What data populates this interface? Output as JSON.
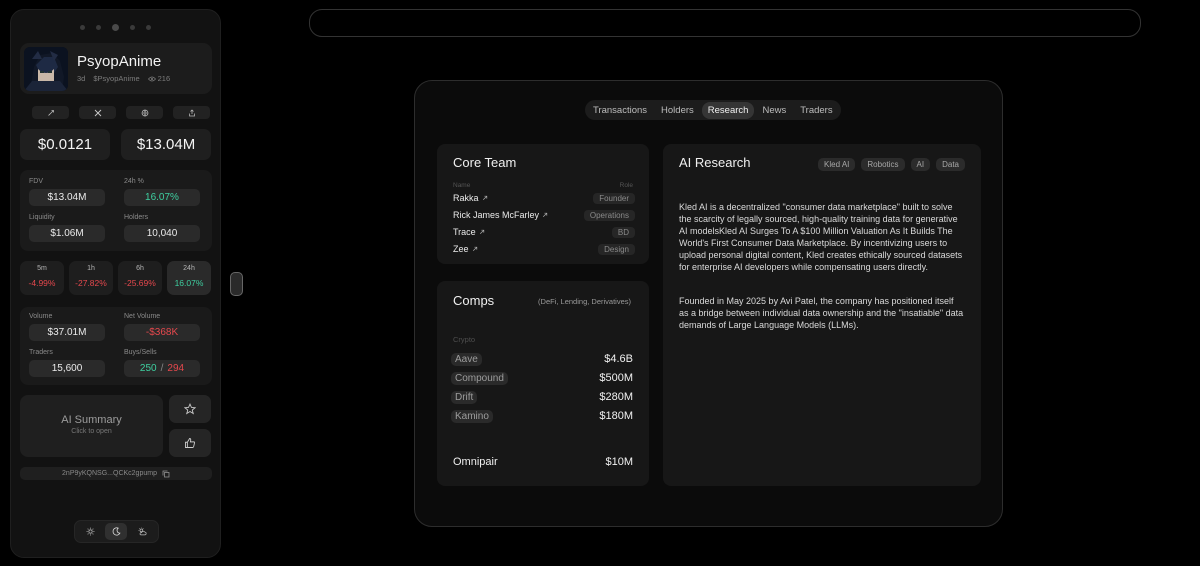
{
  "profile": {
    "name": "PsyopAnime",
    "age": "3d",
    "ticker": "$PsyopAnime",
    "views": "216"
  },
  "prices": {
    "price": "$0.0121",
    "mcap": "$13.04M"
  },
  "stats": {
    "fdv_label": "FDV",
    "fdv": "$13.04M",
    "change_label": "24h %",
    "change": "16.07%",
    "liquidity_label": "Liquidity",
    "liquidity": "$1.06M",
    "holders_label": "Holders",
    "holders": "10,040"
  },
  "timeframes": [
    {
      "label": "5m",
      "value": "-4.99%"
    },
    {
      "label": "1h",
      "value": "-27.82%"
    },
    {
      "label": "6h",
      "value": "-25.69%"
    },
    {
      "label": "24h",
      "value": "16.07%"
    }
  ],
  "volume": {
    "volume_label": "Volume",
    "volume": "$37.01M",
    "net_label": "Net Volume",
    "net": "-$368K",
    "traders_label": "Traders",
    "traders": "15,600",
    "buysells_label": "Buys/Sells",
    "buys": "250",
    "sep": "/",
    "sells": "294"
  },
  "ai_summary": {
    "title": "AI Summary",
    "subtitle": "Click to open"
  },
  "address": "2nP9yKQNSG...QCKc2gpump",
  "tabs": [
    "Transactions",
    "Holders",
    "Research",
    "News",
    "Traders"
  ],
  "active_tab": "Research",
  "core_team": {
    "title": "Core Team",
    "name_header": "Name",
    "role_header": "Role",
    "members": [
      {
        "name": "Rakka",
        "role": "Founder"
      },
      {
        "name": "Rick James McFarley",
        "role": "Operations"
      },
      {
        "name": "Trace",
        "role": "BD"
      },
      {
        "name": "Zee",
        "role": "Design"
      }
    ]
  },
  "comps": {
    "title": "Comps",
    "subtitle": "(DeFi, Lending, Derivatives)",
    "category": "Crypto",
    "items": [
      {
        "name": "Aave",
        "value": "$4.6B"
      },
      {
        "name": "Compound",
        "value": "$500M"
      },
      {
        "name": "Drift",
        "value": "$280M"
      },
      {
        "name": "Kamino",
        "value": "$180M"
      }
    ],
    "self": {
      "name": "Omnipair",
      "value": "$10M"
    }
  },
  "ai_research": {
    "title": "AI Research",
    "tags": [
      "Kled AI",
      "Robotics",
      "AI",
      "Data"
    ],
    "paragraphs": [
      "Kled AI is a decentralized \"consumer data marketplace\" built to solve the scarcity of legally sourced, high-quality training data for generative AI modelsKled AI Surges To A $100 Million Valuation As It Builds The World's First Consumer Data Marketplace. By incentivizing users to upload personal digital content, Kled creates ethically sourced datasets for enterprise AI developers while compensating users directly.",
      "Founded in May 2025 by Avi Patel, the company has positioned itself as a bridge between individual data ownership and the \"insatiable\" data demands of Large Language Models (LLMs)."
    ]
  },
  "colors": {
    "positive": "#3ecfa0",
    "negative": "#e5484d",
    "background": "#000000"
  },
  "icons": {
    "links": [
      "rocket-icon",
      "x-icon",
      "globe-icon",
      "share-icon"
    ],
    "theme": [
      "sun-icon",
      "moon-icon",
      "sun-cloud-icon"
    ]
  }
}
